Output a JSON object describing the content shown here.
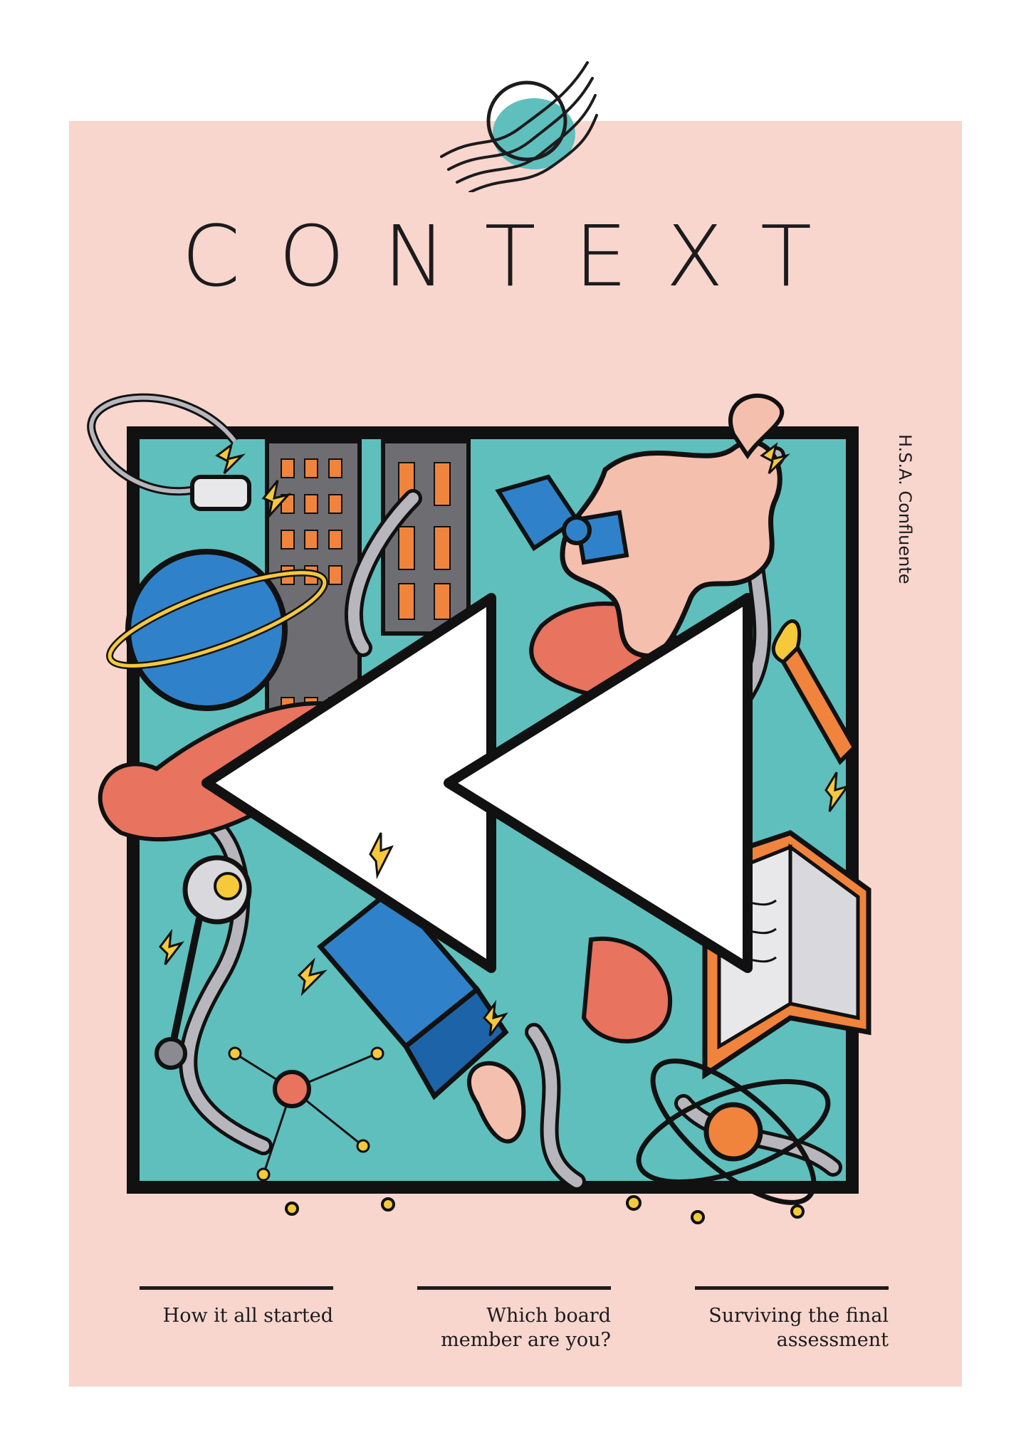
{
  "magazine": {
    "title": "CONTEXT",
    "publisher": "H.S.A. Confluente"
  },
  "cover_art": {
    "icon": "rewind-icon",
    "description_colors": {
      "background": "#f8d6cd",
      "teal": "#5fbfbd",
      "coral": "#e8735f",
      "blue": "#2f82c9",
      "orange": "#f0843d",
      "yellow": "#f5c93a"
    }
  },
  "articles": [
    {
      "line1": "How it all started",
      "line2": ""
    },
    {
      "line1": "Which board",
      "line2": "member are you?"
    },
    {
      "line1": "Surviving the final",
      "line2": "assessment"
    }
  ]
}
